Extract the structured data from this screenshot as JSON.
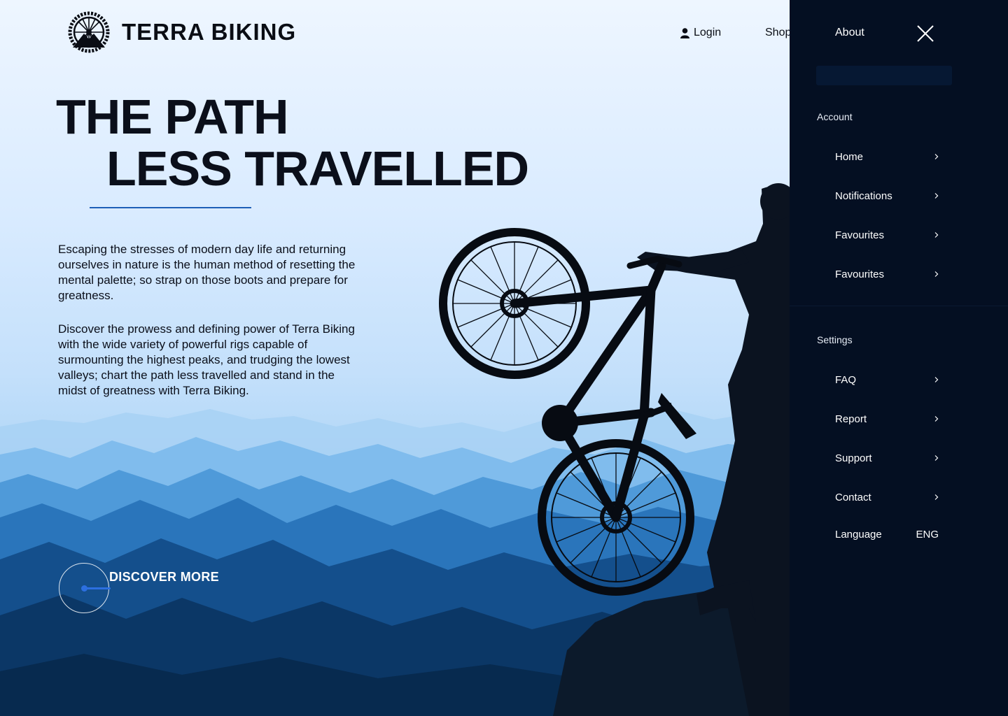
{
  "brand": {
    "name": "TERRA BIKING"
  },
  "top_nav": {
    "login": "Login",
    "shop": "Shop",
    "about": "About"
  },
  "hero": {
    "headline_line1": "THE PATH",
    "headline_line2": "LESS TRAVELLED",
    "paragraph1": "Escaping the stresses of modern day life and returning ourselves in nature is the human method of resetting the mental palette; so strap on those boots and prepare for greatness.",
    "paragraph2": "Discover the prowess and defining power of Terra Biking with the wide variety of powerful rigs capable of surmounting the highest peaks, and trudging the lowest valleys; chart the path less travelled and stand in the midst of greatness with Terra Biking.",
    "cta": "DISCOVER MORE"
  },
  "drawer": {
    "search_placeholder": "",
    "account_label": "Account",
    "account_items": [
      {
        "label": "Home"
      },
      {
        "label": "Notifications"
      },
      {
        "label": "Favourites"
      },
      {
        "label": "Favourites"
      }
    ],
    "settings_label": "Settings",
    "settings_items": [
      {
        "label": "FAQ"
      },
      {
        "label": "Report"
      },
      {
        "label": "Support"
      },
      {
        "label": "Contact"
      }
    ],
    "language_label": "Language",
    "language_value": "ENG"
  },
  "colors": {
    "accent": "#1e5fb7",
    "drawer_bg": "#040f22",
    "text_dark": "#0b0f1a"
  },
  "icons": [
    "user-icon",
    "close-icon",
    "search-icon",
    "chevron-right-icon",
    "bike-wheel-logo-icon"
  ]
}
